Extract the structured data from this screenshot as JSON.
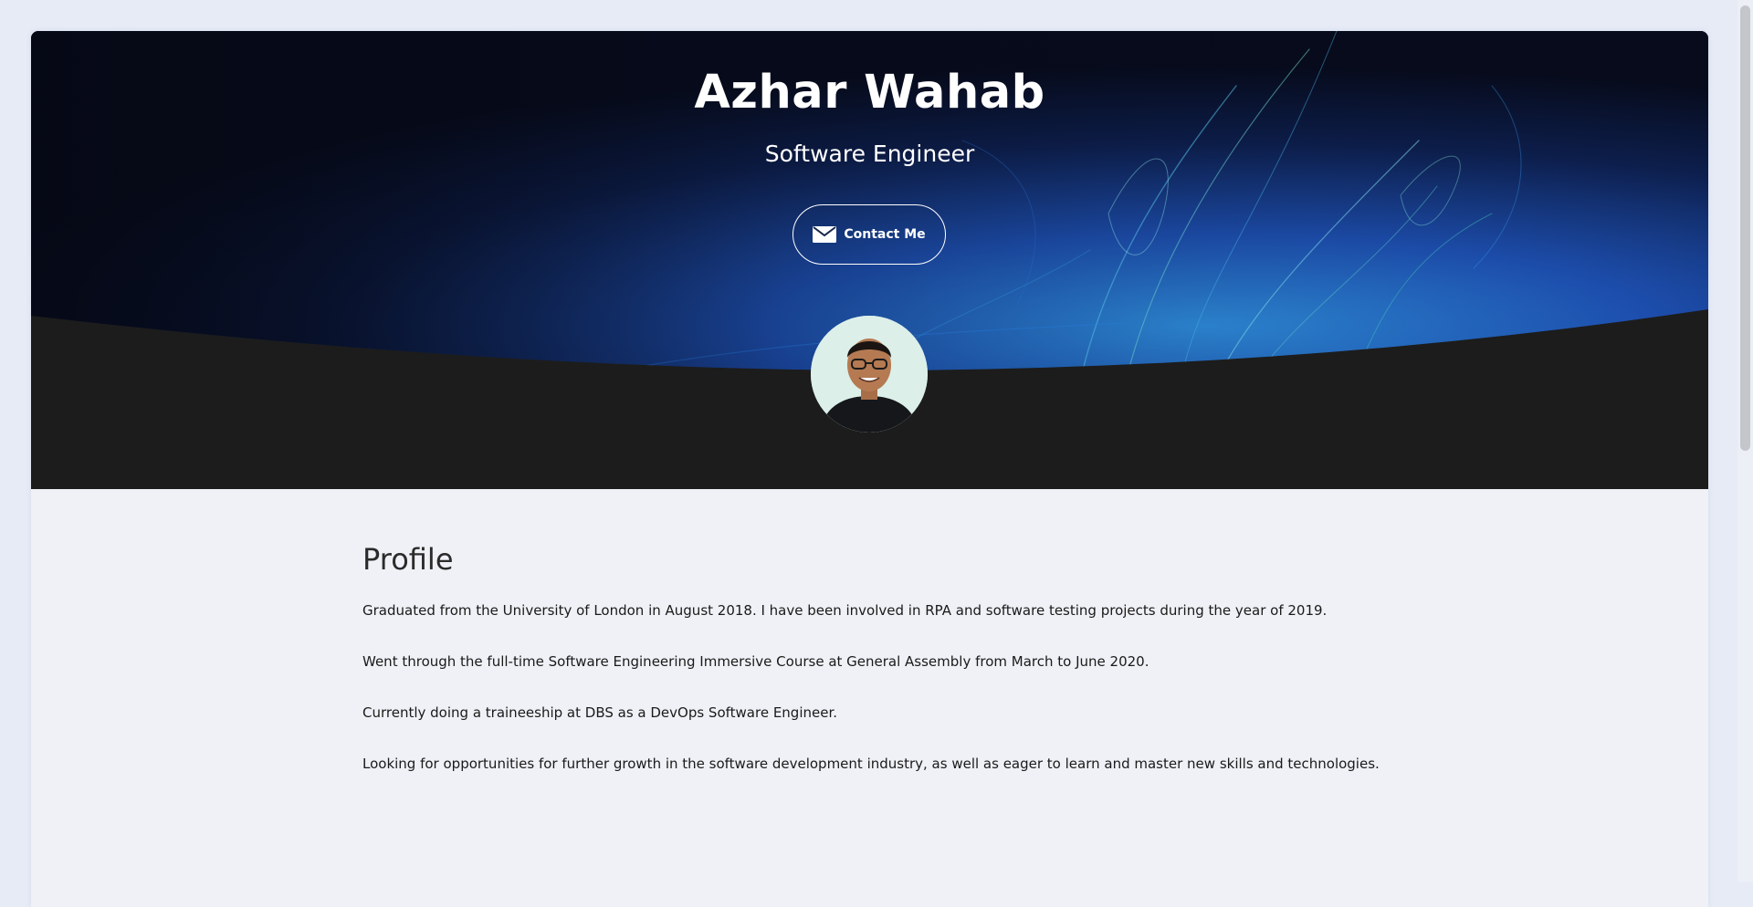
{
  "header": {
    "name": "Azhar Wahab",
    "role": "Software Engineer",
    "contact_button": {
      "label": "Contact Me",
      "icon": "envelope-icon"
    },
    "avatar_icon": "profile-photo"
  },
  "profile": {
    "title": "Profile",
    "paragraphs": [
      "Graduated from the University of London in August 2018. I have been involved in RPA and software testing projects during the year of 2019.",
      "Went through the full-time Software Engineering Immersive Course at General Assembly from March to June 2020.",
      "Currently doing a traineeship at DBS as a DevOps Software Engineer.",
      "Looking for opportunities for further growth in the software development industry, as well as eager to learn and master new skills and technologies."
    ]
  },
  "colors": {
    "page_background": "#e6ebf6",
    "card_background": "#eff1f6",
    "hero_dark": "#1c1c1c",
    "hero_blue": "#1e5fc7",
    "text": "#1a1a1a"
  }
}
